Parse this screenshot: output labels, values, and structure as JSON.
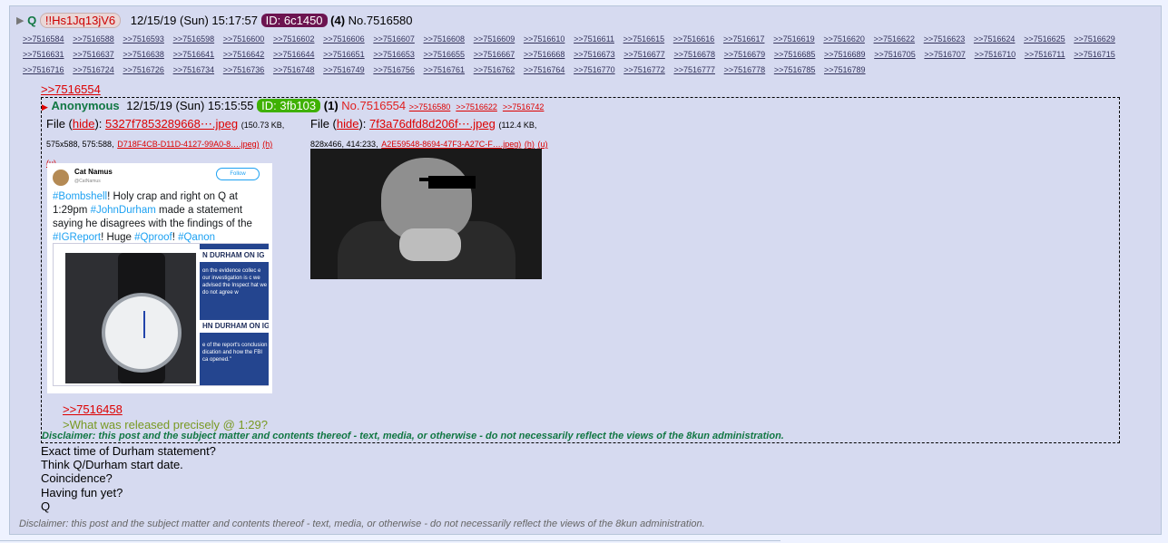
{
  "post": {
    "name": "Q",
    "tripcode": "!!Hs1Jq13jV6",
    "date": "12/15/19 (Sun) 15:17:57",
    "id": "ID: 6c1450",
    "id_count": "(4)",
    "post_no": "No.7516580",
    "backlinks": [
      ">>7516584",
      ">>7516588",
      ">>7516593",
      ">>7516598",
      ">>7516600",
      ">>7516602",
      ">>7516606",
      ">>7516607",
      ">>7516608",
      ">>7516609",
      ">>7516610",
      ">>7516611",
      ">>7516615",
      ">>7516616",
      ">>7516617",
      ">>7516619",
      ">>7516620",
      ">>7516622",
      ">>7516623",
      ">>7516624",
      ">>7516625",
      ">>7516629",
      ">>7516631",
      ">>7516637",
      ">>7516638",
      ">>7516641",
      ">>7516642",
      ">>7516644",
      ">>7516651",
      ">>7516653",
      ">>7516655",
      ">>7516667",
      ">>7516668",
      ">>7516673",
      ">>7516677",
      ">>7516678",
      ">>7516679",
      ">>7516685",
      ">>7516689",
      ">>7516705",
      ">>7516707",
      ">>7516710",
      ">>7516711",
      ">>7516715",
      ">>7516716",
      ">>7516724",
      ">>7516726",
      ">>7516734",
      ">>7516736",
      ">>7516748",
      ">>7516749",
      ">>7516756",
      ">>7516761",
      ">>7516762",
      ">>7516764",
      ">>7516770",
      ">>7516772",
      ">>7516777",
      ">>7516778",
      ">>7516785",
      ">>7516789"
    ],
    "quote_link": ">>7516554",
    "body_lines": [
      "Exact time of Durham statement?",
      "Think Q/Durham start date.",
      "Coincidence?",
      "Having fun yet?",
      "Q"
    ],
    "disclaimer": "Disclaimer: this post and the subject matter and contents thereof - text, media, or otherwise - do not necessarily reflect the views of the 8kun administration."
  },
  "quoted": {
    "name": "Anonymous",
    "date": "12/15/19 (Sun) 15:15:55",
    "id": "ID: 3fb103",
    "id_count": "(1)",
    "post_no": "No.7516554",
    "backlinks": [
      ">>7516580",
      ">>7516622",
      ">>7516742"
    ],
    "file1": {
      "label": "File (",
      "hide": "hide",
      "close": "):",
      "name": "5327f7853289668⋯.jpeg",
      "size": "(150.73 KB,",
      "dims": "575x588, 575:588,",
      "orig": "D718F4CB-D11D-4127-99A0-8….jpeg)",
      "h": "(h)",
      "u": "(u)"
    },
    "file2": {
      "label": "File (",
      "hide": "hide",
      "close": "):",
      "name": "7f3a76dfd8d206f⋯.jpeg",
      "size": "(112.4 KB,",
      "dims": "828x466, 414:233,",
      "orig": "A2E59548-8694-47F3-A27C-F….jpeg)",
      "h": "(h)",
      "u": "(u)"
    },
    "tweet": {
      "name": "Cat Namus",
      "handle": "@CatNamus",
      "follow": "Follow",
      "tags": [
        "#Bombshell",
        "#JohnDurham",
        "#IGReport",
        "#Qproof",
        "#Qanon"
      ],
      "t1": "! Holy crap and right on Q at 1:29pm ",
      "t2": " made a statement saying he disagrees with the findings of the ",
      "t3": "! Huge ",
      "t4": "! ",
      "tv_band1": "N DURHAM ON IG",
      "tv_text1": "on the evidence collec e our investigation is c we advised the Inspect hat we do not agree w",
      "tv_band2": "HN DURHAM ON IG RE",
      "tv_text2": "e of the report's conclusion dication and how the FBI ca opened.\""
    },
    "reply_link": ">>7516458",
    "greentext": ">What was released precisely @ 1:29?",
    "disclaimer": "Disclaimer: this post and the subject matter and contents thereof - text, media, or otherwise - do not necessarily reflect the views of the 8kun administration."
  },
  "colors": {
    "bg": "#eef2ff",
    "post_bg": "#d6daf0",
    "name_green": "#117743",
    "link_red": "#dd0000",
    "greentext": "#789922",
    "id_q": "#6c1450",
    "id_anon": "#3fb103"
  }
}
